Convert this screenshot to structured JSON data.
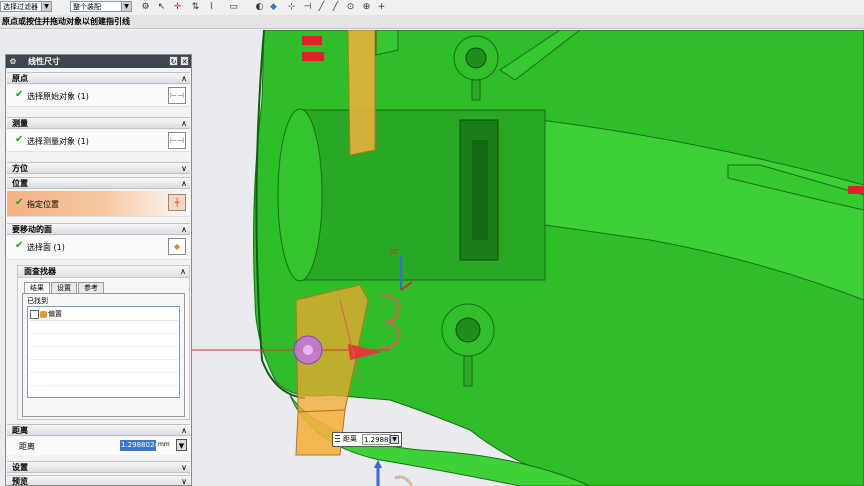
{
  "toolbar": {
    "filter_combo": "选择过滤器",
    "assembly_combo": "整个装配"
  },
  "status": {
    "prompt": "原点或按住并拖动对象以创建指引线"
  },
  "dialog": {
    "title": "线性尺寸",
    "sections": {
      "origin": {
        "label": "原点",
        "row_text": "选择原始对象 (1)"
      },
      "measure": {
        "label": "测量",
        "row_text": "选择测量对象 (1)"
      },
      "orientation": {
        "label": "方位"
      },
      "position": {
        "label": "位置",
        "row_text": "指定位置"
      },
      "face_to_move": {
        "label": "要移动的面",
        "row_text": "选择面 (1)"
      },
      "face_finder": {
        "label": "面查找器",
        "tabs": [
          "结果",
          "设置",
          "参考"
        ],
        "found_label": "已找到",
        "items": [
          "偏置"
        ]
      },
      "distance": {
        "label": "距离",
        "field_label": "距离",
        "value": "1.2988024",
        "unit": "mm"
      },
      "settings": {
        "label": "设置"
      },
      "preview": {
        "label": "预览"
      }
    }
  },
  "viewport_tooltip": {
    "label": "距离",
    "value": "1.29880"
  },
  "axis_label": "XC",
  "colors": {
    "model_green": "#2fbe2a",
    "model_dark_green": "#1d8c1a",
    "handle_orange": "#f0a830",
    "dialog_title_bar": "#3d4651",
    "selection_blue": "#3d76c6"
  }
}
